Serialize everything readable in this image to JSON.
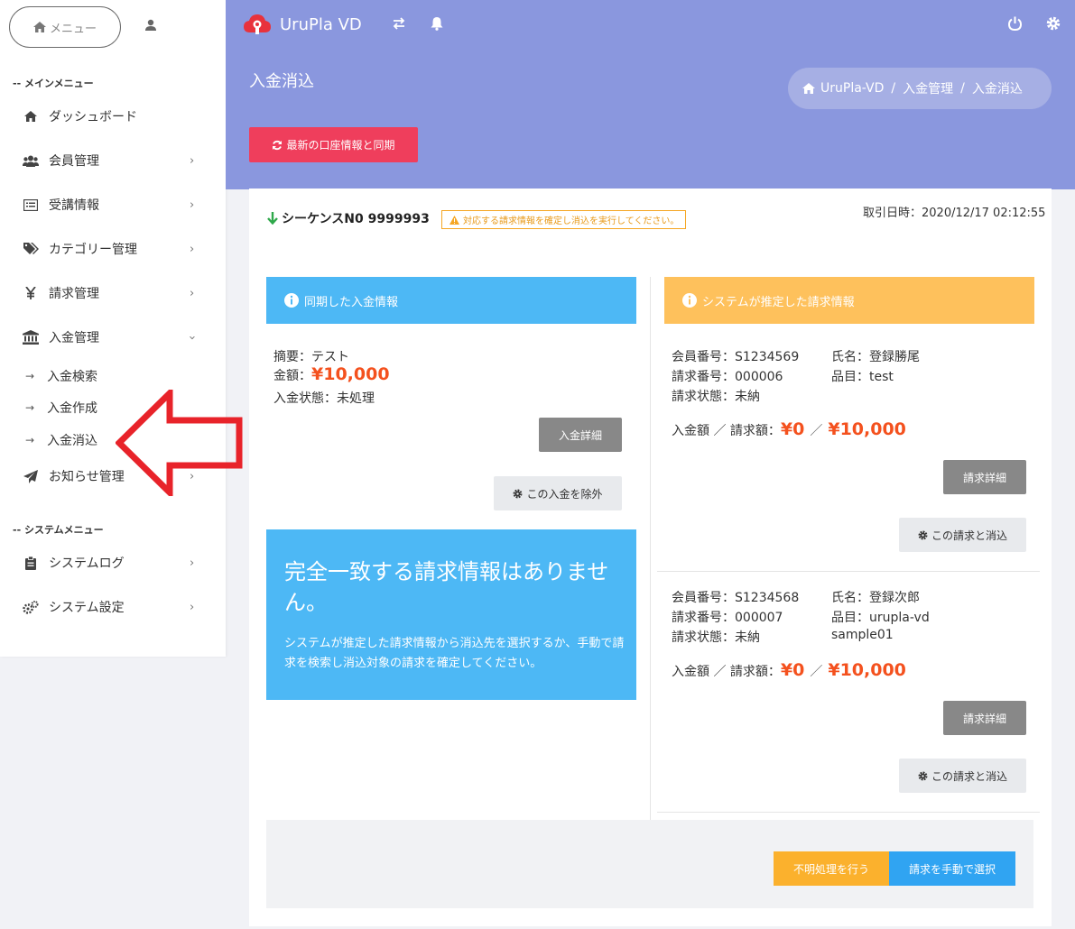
{
  "sidebar": {
    "menu_label": "メニュー",
    "main_section": "-- メインメニュー",
    "items": [
      {
        "label": "ダッシュボード",
        "icon": "home-icon"
      },
      {
        "label": "会員管理",
        "icon": "users-icon"
      },
      {
        "label": "受講情報",
        "icon": "list-icon"
      },
      {
        "label": "カテゴリー管理",
        "icon": "tags-icon"
      },
      {
        "label": "請求管理",
        "icon": "yen-icon"
      },
      {
        "label": "入金管理",
        "icon": "bank-icon"
      }
    ],
    "sub_items": [
      {
        "label": "入金検索"
      },
      {
        "label": "入金作成"
      },
      {
        "label": "入金消込"
      }
    ],
    "sub_arrow": "→",
    "news_label": "お知らせ管理",
    "system_section": "-- システムメニュー",
    "system_items": [
      {
        "label": "システムログ",
        "icon": "clipboard-icon"
      },
      {
        "label": "システム設定",
        "icon": "cogs-icon"
      }
    ]
  },
  "header": {
    "brand": "UruPla VD",
    "page_title": "入金消込",
    "breadcrumb": [
      "UruPla-VD",
      "入金管理",
      "入金消込"
    ],
    "breadcrumb_sep": "/",
    "sync_button": "最新の口座情報と同期",
    "bg_color": "#8a97de"
  },
  "sequence": {
    "label": "シーケンスN0 9999993",
    "warning": "対応する請求情報を確定し消込を実行してください。",
    "trade_date": "取引日時：2020/12/17 02:12:55"
  },
  "deposit": {
    "header": "同期した入金情報",
    "summary": "摘要：テスト",
    "amount_label": "金額：",
    "amount": "¥10,000",
    "status": "入金状態：未処理",
    "detail_button": "入金詳細",
    "exclude_button": "この入金を除外"
  },
  "nomatch": {
    "title": "完全一致する請求情報はありません。",
    "text": "システムが推定した請求情報から消込先を選択するか、手動で請求を検索し消込対象の請求を確定してください。"
  },
  "estimated": {
    "header": "システムが推定した請求情報",
    "bills": [
      {
        "member_no": "会員番号：S1234569",
        "name": "氏名：登録勝尾",
        "bill_no": "請求番号：000006",
        "item": "品目：test",
        "item2": "",
        "status": "請求状態：未納",
        "amount_label": "入金額 ／ 請求額：",
        "paid": "¥0",
        "slash": "／",
        "billed": "¥10,000",
        "detail_button": "請求詳細",
        "apply_button": "この請求と消込"
      },
      {
        "member_no": "会員番号：S1234568",
        "name": "氏名：登録次郎",
        "bill_no": "請求番号：000007",
        "item": "品目：urupla-vd",
        "item2": "sample01",
        "status": "請求状態：未納",
        "amount_label": "入金額 ／ 請求額：",
        "paid": "¥0",
        "slash": "／",
        "billed": "¥10,000",
        "detail_button": "請求詳細",
        "apply_button": "この請求と消込"
      }
    ]
  },
  "footer": {
    "unknown_button": "不明処理を行う",
    "manual_button": "請求を手動で選択"
  }
}
